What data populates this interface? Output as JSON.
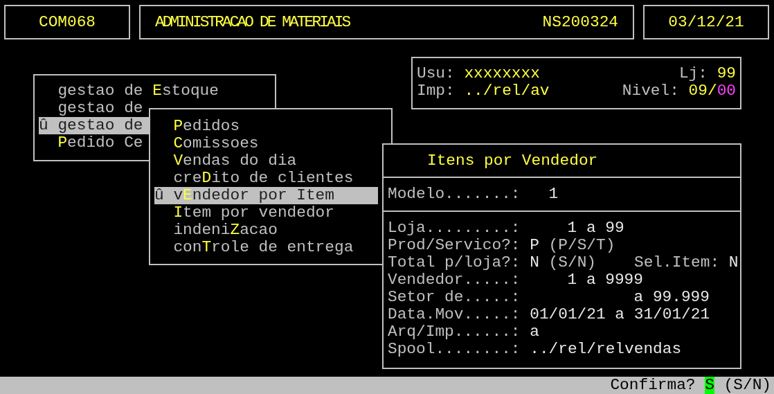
{
  "header": {
    "program": "COM068",
    "title": "ADMINISTRACAO DE MATERIAIS",
    "code": "NS200324",
    "date": "03/12/21"
  },
  "info": {
    "rows": [
      {
        "left": [
          {
            "kind": "label",
            "text": "Usu:"
          },
          {
            "kind": "value",
            "text": "xxxxxxxx"
          }
        ],
        "right": [
          {
            "kind": "label",
            "text": "Lj:"
          },
          {
            "kind": "value",
            "text": "99"
          }
        ]
      },
      {
        "left": [
          {
            "kind": "label",
            "text": "Imp:"
          },
          {
            "kind": "value",
            "text": "../rel/av"
          }
        ],
        "right": [
          {
            "kind": "label",
            "text": "Nivel:"
          },
          {
            "kind": "value",
            "text": "09/"
          },
          {
            "kind": "alert",
            "text": "00"
          }
        ]
      }
    ]
  },
  "main_menu": {
    "items": [
      {
        "before": "gestao de ",
        "key": "E",
        "after": "stoque",
        "selected": false
      },
      {
        "before": "gestao de",
        "selected": false
      },
      {
        "prefix": "û",
        "before": "gestao de",
        "selected": true
      },
      {
        "key": "P",
        "after": "edido Ce",
        "selected": false
      }
    ]
  },
  "sub_menu": {
    "items": [
      {
        "key": "P",
        "after": "edidos",
        "selected": false
      },
      {
        "key": "C",
        "after": "omissoes",
        "selected": false
      },
      {
        "key": "V",
        "after": "endas do dia",
        "selected": false
      },
      {
        "before": "cre",
        "key": "D",
        "after": "ito de clientes",
        "selected": false
      },
      {
        "prefix": "û",
        "before": "v",
        "key": "E",
        "after": "ndedor por Item",
        "selected": true
      },
      {
        "key": "I",
        "after": "tem por vendedor",
        "selected": false
      },
      {
        "before": "indeni",
        "key": "Z",
        "after": "acao",
        "selected": false
      },
      {
        "before": "con",
        "key": "T",
        "after": "role de entrega",
        "selected": false
      }
    ]
  },
  "form": {
    "title": "Itens por Vendedor",
    "model": [
      {
        "kind": "label",
        "text": "Modelo.......:"
      },
      {
        "kind": "value",
        "text": "1"
      }
    ],
    "rows": [
      [
        {
          "kind": "label",
          "text": "Loja.........:"
        },
        {
          "kind": "value",
          "text": "1 a 99"
        }
      ],
      [
        {
          "kind": "label",
          "text": "Prod/Servico?:"
        },
        {
          "kind": "value",
          "text": "P"
        },
        {
          "kind": "label",
          "text": "(P/S/T)"
        }
      ],
      [
        {
          "kind": "label",
          "text": "Total p/loja?:"
        },
        {
          "kind": "value",
          "text": "N"
        },
        {
          "kind": "label",
          "text": "(S/N)"
        },
        {
          "kind": "label",
          "text": "Sel.Item:"
        },
        {
          "kind": "value",
          "text": "N"
        }
      ],
      [
        {
          "kind": "label",
          "text": "Vendedor.....:"
        },
        {
          "kind": "value",
          "text": "1 a 9999"
        }
      ],
      [
        {
          "kind": "label",
          "text": "Setor de.....:"
        },
        {
          "kind": "value",
          "text": "a 99.999"
        }
      ],
      [
        {
          "kind": "label",
          "text": "Data.Mov.....:"
        },
        {
          "kind": "value",
          "text": "01/01/21 a 31/01/21"
        }
      ],
      [
        {
          "kind": "label",
          "text": "Arq/Imp......:"
        },
        {
          "kind": "value",
          "text": "a"
        }
      ],
      [
        {
          "kind": "label",
          "text": "Spool........:"
        },
        {
          "kind": "value",
          "text": "../rel/relvendas"
        }
      ]
    ]
  },
  "status_bar": {
    "prompt": "Confirma?",
    "answer": "S",
    "options": "(S/N)"
  }
}
